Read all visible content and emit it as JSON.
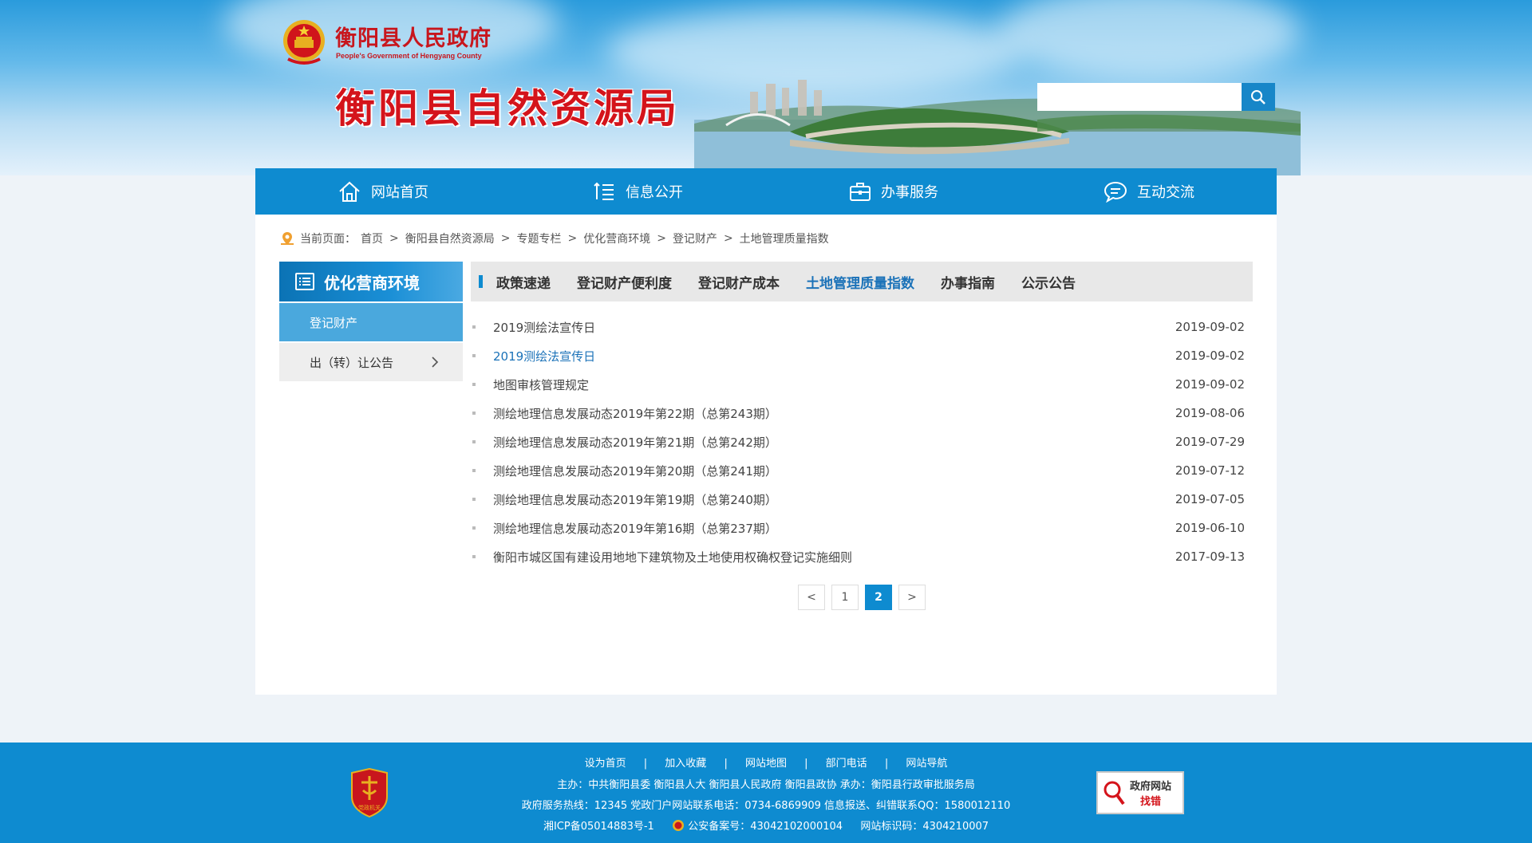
{
  "header": {
    "gov_name": "衡阳县人民政府",
    "gov_name_en": "People's Government of Hengyang County",
    "bureau_title": "衡阳县自然资源局",
    "search": {
      "placeholder": "",
      "icon": "search-icon"
    }
  },
  "nav": [
    {
      "label": "网站首页",
      "icon": "home-icon"
    },
    {
      "label": "信息公开",
      "icon": "list-icon"
    },
    {
      "label": "办事服务",
      "icon": "briefcase-icon"
    },
    {
      "label": "互动交流",
      "icon": "chat-icon"
    }
  ],
  "breadcrumb": {
    "prefix": "当前页面：",
    "items": [
      "首页",
      "衡阳县自然资源局",
      "专题专栏",
      "优化营商环境",
      "登记财产",
      "土地管理质量指数"
    ],
    "separator": ">"
  },
  "sidebar": {
    "title": "优化营商环境",
    "items": [
      {
        "label": "登记财产",
        "active": true
      },
      {
        "label": "出（转）让公告",
        "active": false
      }
    ]
  },
  "tabs": [
    {
      "label": "政策速递",
      "active": false
    },
    {
      "label": "登记财产便利度",
      "active": false
    },
    {
      "label": "登记财产成本",
      "active": false
    },
    {
      "label": "土地管理质量指数",
      "active": true
    },
    {
      "label": "办事指南",
      "active": false
    },
    {
      "label": "公示公告",
      "active": false
    }
  ],
  "articles": [
    {
      "title": "2019测绘法宣传日",
      "date": "2019-09-02",
      "highlight": false
    },
    {
      "title": "2019测绘法宣传日",
      "date": "2019-09-02",
      "highlight": true
    },
    {
      "title": "地图审核管理规定",
      "date": "2019-09-02",
      "highlight": false
    },
    {
      "title": "测绘地理信息发展动态2019年第22期（总第243期）",
      "date": "2019-08-06",
      "highlight": false
    },
    {
      "title": "测绘地理信息发展动态2019年第21期（总第242期）",
      "date": "2019-07-29",
      "highlight": false
    },
    {
      "title": "测绘地理信息发展动态2019年第20期（总第241期）",
      "date": "2019-07-12",
      "highlight": false
    },
    {
      "title": "测绘地理信息发展动态2019年第19期（总第240期）",
      "date": "2019-07-05",
      "highlight": false
    },
    {
      "title": "测绘地理信息发展动态2019年第16期（总第237期）",
      "date": "2019-06-10",
      "highlight": false
    },
    {
      "title": "衡阳市城区国有建设用地地下建筑物及土地使用权确权登记实施细则",
      "date": "2017-09-13",
      "highlight": false
    }
  ],
  "pagination": {
    "prev": "<",
    "pages": [
      "1",
      "2"
    ],
    "current": "2",
    "next": ">"
  },
  "footer": {
    "links": [
      "设为首页",
      "加入收藏",
      "网站地图",
      "部门电话",
      "网站导航"
    ],
    "link_separator": "|",
    "sponsor": "主办：中共衡阳县委 衡阳县人大 衡阳县人民政府 衡阳县政协 承办：衡阳县行政审批服务局",
    "hotline": "政府服务热线：12345 党政门户网站联系电话：0734-6869909 信息报送、纠错联系QQ：1580012110",
    "icp": "湘ICP备05014883号-1",
    "police_record": "公安备案号：43042102000104",
    "site_id": "网站标识码：4304210007",
    "party_badge_text": "党政机关",
    "error_badge": {
      "line1": "政府网站",
      "line2": "找错"
    }
  },
  "colors": {
    "primary": "#0e8bd0",
    "title_red": "#d4141b",
    "link_blue": "#1b72b8"
  }
}
